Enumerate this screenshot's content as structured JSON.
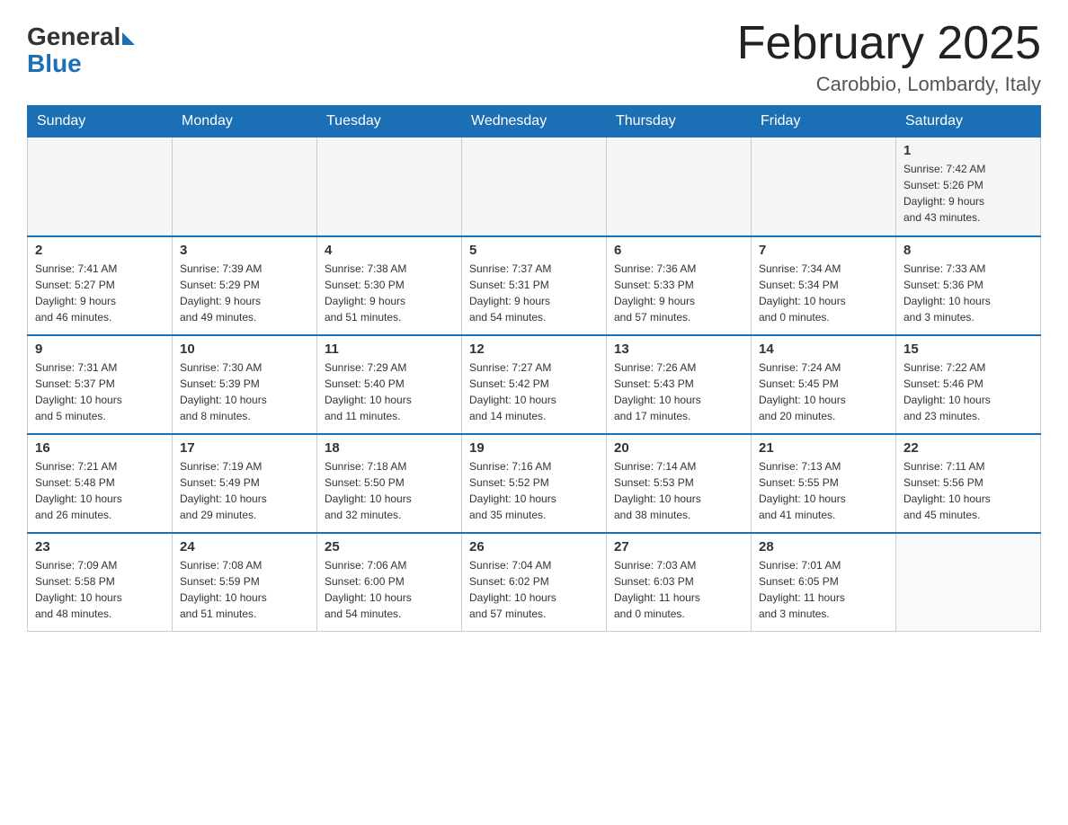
{
  "logo": {
    "text_general": "General",
    "text_blue": "Blue"
  },
  "title": "February 2025",
  "location": "Carobbio, Lombardy, Italy",
  "days_of_week": [
    "Sunday",
    "Monday",
    "Tuesday",
    "Wednesday",
    "Thursday",
    "Friday",
    "Saturday"
  ],
  "weeks": [
    [
      {
        "day": "",
        "info": ""
      },
      {
        "day": "",
        "info": ""
      },
      {
        "day": "",
        "info": ""
      },
      {
        "day": "",
        "info": ""
      },
      {
        "day": "",
        "info": ""
      },
      {
        "day": "",
        "info": ""
      },
      {
        "day": "1",
        "info": "Sunrise: 7:42 AM\nSunset: 5:26 PM\nDaylight: 9 hours\nand 43 minutes."
      }
    ],
    [
      {
        "day": "2",
        "info": "Sunrise: 7:41 AM\nSunset: 5:27 PM\nDaylight: 9 hours\nand 46 minutes."
      },
      {
        "day": "3",
        "info": "Sunrise: 7:39 AM\nSunset: 5:29 PM\nDaylight: 9 hours\nand 49 minutes."
      },
      {
        "day": "4",
        "info": "Sunrise: 7:38 AM\nSunset: 5:30 PM\nDaylight: 9 hours\nand 51 minutes."
      },
      {
        "day": "5",
        "info": "Sunrise: 7:37 AM\nSunset: 5:31 PM\nDaylight: 9 hours\nand 54 minutes."
      },
      {
        "day": "6",
        "info": "Sunrise: 7:36 AM\nSunset: 5:33 PM\nDaylight: 9 hours\nand 57 minutes."
      },
      {
        "day": "7",
        "info": "Sunrise: 7:34 AM\nSunset: 5:34 PM\nDaylight: 10 hours\nand 0 minutes."
      },
      {
        "day": "8",
        "info": "Sunrise: 7:33 AM\nSunset: 5:36 PM\nDaylight: 10 hours\nand 3 minutes."
      }
    ],
    [
      {
        "day": "9",
        "info": "Sunrise: 7:31 AM\nSunset: 5:37 PM\nDaylight: 10 hours\nand 5 minutes."
      },
      {
        "day": "10",
        "info": "Sunrise: 7:30 AM\nSunset: 5:39 PM\nDaylight: 10 hours\nand 8 minutes."
      },
      {
        "day": "11",
        "info": "Sunrise: 7:29 AM\nSunset: 5:40 PM\nDaylight: 10 hours\nand 11 minutes."
      },
      {
        "day": "12",
        "info": "Sunrise: 7:27 AM\nSunset: 5:42 PM\nDaylight: 10 hours\nand 14 minutes."
      },
      {
        "day": "13",
        "info": "Sunrise: 7:26 AM\nSunset: 5:43 PM\nDaylight: 10 hours\nand 17 minutes."
      },
      {
        "day": "14",
        "info": "Sunrise: 7:24 AM\nSunset: 5:45 PM\nDaylight: 10 hours\nand 20 minutes."
      },
      {
        "day": "15",
        "info": "Sunrise: 7:22 AM\nSunset: 5:46 PM\nDaylight: 10 hours\nand 23 minutes."
      }
    ],
    [
      {
        "day": "16",
        "info": "Sunrise: 7:21 AM\nSunset: 5:48 PM\nDaylight: 10 hours\nand 26 minutes."
      },
      {
        "day": "17",
        "info": "Sunrise: 7:19 AM\nSunset: 5:49 PM\nDaylight: 10 hours\nand 29 minutes."
      },
      {
        "day": "18",
        "info": "Sunrise: 7:18 AM\nSunset: 5:50 PM\nDaylight: 10 hours\nand 32 minutes."
      },
      {
        "day": "19",
        "info": "Sunrise: 7:16 AM\nSunset: 5:52 PM\nDaylight: 10 hours\nand 35 minutes."
      },
      {
        "day": "20",
        "info": "Sunrise: 7:14 AM\nSunset: 5:53 PM\nDaylight: 10 hours\nand 38 minutes."
      },
      {
        "day": "21",
        "info": "Sunrise: 7:13 AM\nSunset: 5:55 PM\nDaylight: 10 hours\nand 41 minutes."
      },
      {
        "day": "22",
        "info": "Sunrise: 7:11 AM\nSunset: 5:56 PM\nDaylight: 10 hours\nand 45 minutes."
      }
    ],
    [
      {
        "day": "23",
        "info": "Sunrise: 7:09 AM\nSunset: 5:58 PM\nDaylight: 10 hours\nand 48 minutes."
      },
      {
        "day": "24",
        "info": "Sunrise: 7:08 AM\nSunset: 5:59 PM\nDaylight: 10 hours\nand 51 minutes."
      },
      {
        "day": "25",
        "info": "Sunrise: 7:06 AM\nSunset: 6:00 PM\nDaylight: 10 hours\nand 54 minutes."
      },
      {
        "day": "26",
        "info": "Sunrise: 7:04 AM\nSunset: 6:02 PM\nDaylight: 10 hours\nand 57 minutes."
      },
      {
        "day": "27",
        "info": "Sunrise: 7:03 AM\nSunset: 6:03 PM\nDaylight: 11 hours\nand 0 minutes."
      },
      {
        "day": "28",
        "info": "Sunrise: 7:01 AM\nSunset: 6:05 PM\nDaylight: 11 hours\nand 3 minutes."
      },
      {
        "day": "",
        "info": ""
      }
    ]
  ]
}
